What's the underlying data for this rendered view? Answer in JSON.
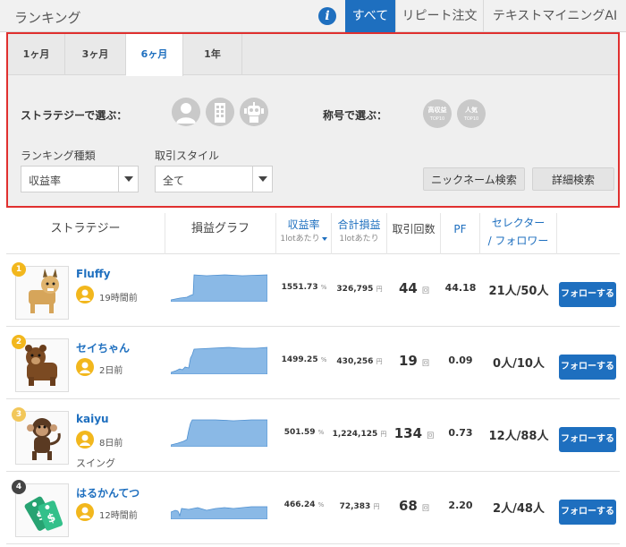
{
  "header": {
    "title": "ランキング",
    "tabs": [
      "すべて",
      "リピート注文",
      "テキストマイニングAI"
    ]
  },
  "filter": {
    "periods": [
      "1ヶ月",
      "3ヶ月",
      "6ヶ月",
      "1年"
    ],
    "active_period": "6ヶ月",
    "strategy_label": "ストラテジーで選ぶ：",
    "strategy_icons": [
      "person-icon",
      "building-icon",
      "robot-icon"
    ],
    "title_label": "称号で選ぶ：",
    "title_badges": [
      {
        "main": "高収益",
        "sub": "TOP10"
      },
      {
        "main": "人気",
        "sub": "TOP10"
      }
    ],
    "ranking_type_label": "ランキング種類",
    "ranking_type_value": "収益率",
    "trade_style_label": "取引スタイル",
    "trade_style_value": "全て",
    "nickname_search": "ニックネーム検索",
    "detail_search": "詳細検索"
  },
  "table": {
    "headers": {
      "strategy": "ストラテジー",
      "graph": "損益グラフ",
      "return": "収益率",
      "return_sub": "1lotあたり",
      "pl": "合計損益",
      "pl_sub": "1lotあたり",
      "trades": "取引回数",
      "pf": "PF",
      "selector": "セレクター",
      "follower": "/ フォロワー"
    },
    "rows": [
      {
        "rank": "1",
        "rank_color": "#f2b71d",
        "name": "Fluffy",
        "time": "19時間前",
        "style": "",
        "return": "1551.73",
        "return_unit": "%",
        "pl": "326,795",
        "pl_unit": "円",
        "trades": "44",
        "trades_unit": "回",
        "pf": "44.18",
        "sel": "21人/50人",
        "follow": "フォローする",
        "thumb": "lynx-icon"
      },
      {
        "rank": "2",
        "rank_color": "#f2b71d",
        "name": "セイちゃん",
        "time": "2日前",
        "style": "",
        "return": "1499.25",
        "return_unit": "%",
        "pl": "430,256",
        "pl_unit": "円",
        "trades": "19",
        "trades_unit": "回",
        "pf": "0.09",
        "sel": "0人/10人",
        "follow": "フォローする",
        "thumb": "bear-icon"
      },
      {
        "rank": "3",
        "rank_color": "#f2c75a",
        "name": "kaiyu",
        "time": "8日前",
        "style": "スイング",
        "return": "501.59",
        "return_unit": "%",
        "pl": "1,224,125",
        "pl_unit": "円",
        "trades": "134",
        "trades_unit": "回",
        "pf": "0.73",
        "sel": "12人/88人",
        "follow": "フォローする",
        "thumb": "monkey-icon"
      },
      {
        "rank": "4",
        "rank_color": "#444444",
        "name": "はるかんてつ",
        "time": "12時間前",
        "style": "",
        "return": "466.24",
        "return_unit": "%",
        "pl": "72,383",
        "pl_unit": "円",
        "trades": "68",
        "trades_unit": "回",
        "pf": "2.20",
        "sel": "2人/48人",
        "follow": "フォローする",
        "thumb": "money-tag-icon"
      }
    ]
  },
  "colors": {
    "accent": "#1e6fbf",
    "highlight_border": "#e0302f",
    "rank_gold": "#f2b71d"
  }
}
